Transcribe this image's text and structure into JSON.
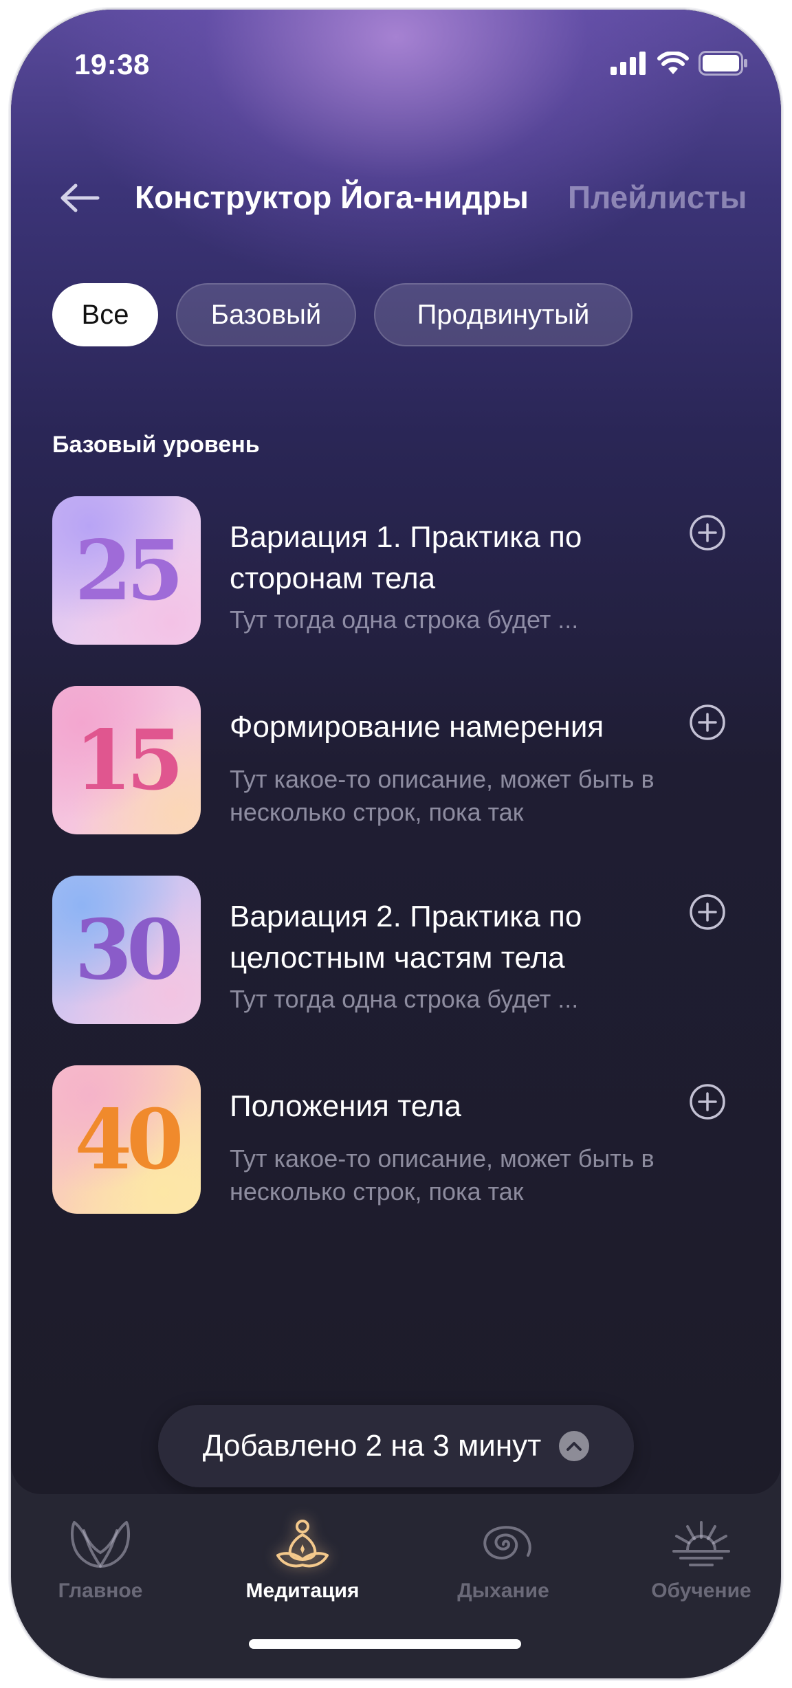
{
  "status_bar": {
    "time": "19:38"
  },
  "header": {
    "title": "Конструктор Йога-нидры",
    "secondary_tab": "Плейлисты"
  },
  "filters": [
    {
      "label": "Все",
      "active": true
    },
    {
      "label": "Базовый",
      "active": false
    },
    {
      "label": "Продвинутый",
      "active": false
    }
  ],
  "section_title": "Базовый уровень",
  "items": [
    {
      "number": "25",
      "title": "Вариация 1. Практика по сторонам тела",
      "description": "Тут тогда одна строка будет ..."
    },
    {
      "number": "15",
      "title": "Формирование намерения",
      "description": "Тут какое-то описание, может быть в несколько строк, пока так"
    },
    {
      "number": "30",
      "title": "Вариация 2. Практика по целостным частям тела",
      "description": "Тут тогда одна строка будет ..."
    },
    {
      "number": "40",
      "title": "Положения тела",
      "description": "Тут какое-то описание, может быть в несколько строк, пока так"
    }
  ],
  "added_bar": {
    "text": "Добавлено 2 на 3 минут"
  },
  "tabbar": [
    {
      "label": "Главное",
      "icon": "lotus-hands-icon",
      "active": false
    },
    {
      "label": "Медитация",
      "icon": "meditation-icon",
      "active": true
    },
    {
      "label": "Дыхание",
      "icon": "spiral-icon",
      "active": false
    },
    {
      "label": "Обучение",
      "icon": "sunrise-icon",
      "active": false
    }
  ],
  "colors": {
    "active_glow": "#f4c98c",
    "accent_bg": "#3c3478",
    "background": "#1d1c29"
  }
}
